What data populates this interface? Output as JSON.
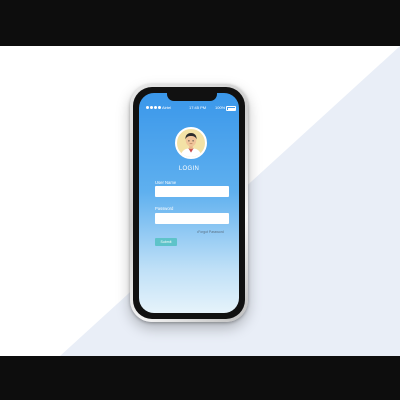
{
  "status_bar": {
    "carrier": "Airtel",
    "time": "17:45 PM",
    "battery": "100%"
  },
  "login": {
    "title": "LOGIN",
    "username_label": "User Name",
    "username_value": "",
    "password_label": "Password",
    "password_value": "",
    "forgot_label": "Forgot Password",
    "submit_label": "Submit"
  },
  "colors": {
    "screen_top": "#3a97ea",
    "screen_bottom": "#e6f3fb",
    "submit_button": "#5ec3c9",
    "stage_diagonal": "#e9eef7"
  },
  "icons": {
    "avatar": "user-avatar-icon",
    "battery": "battery-icon",
    "signal": "signal-dots-icon"
  }
}
